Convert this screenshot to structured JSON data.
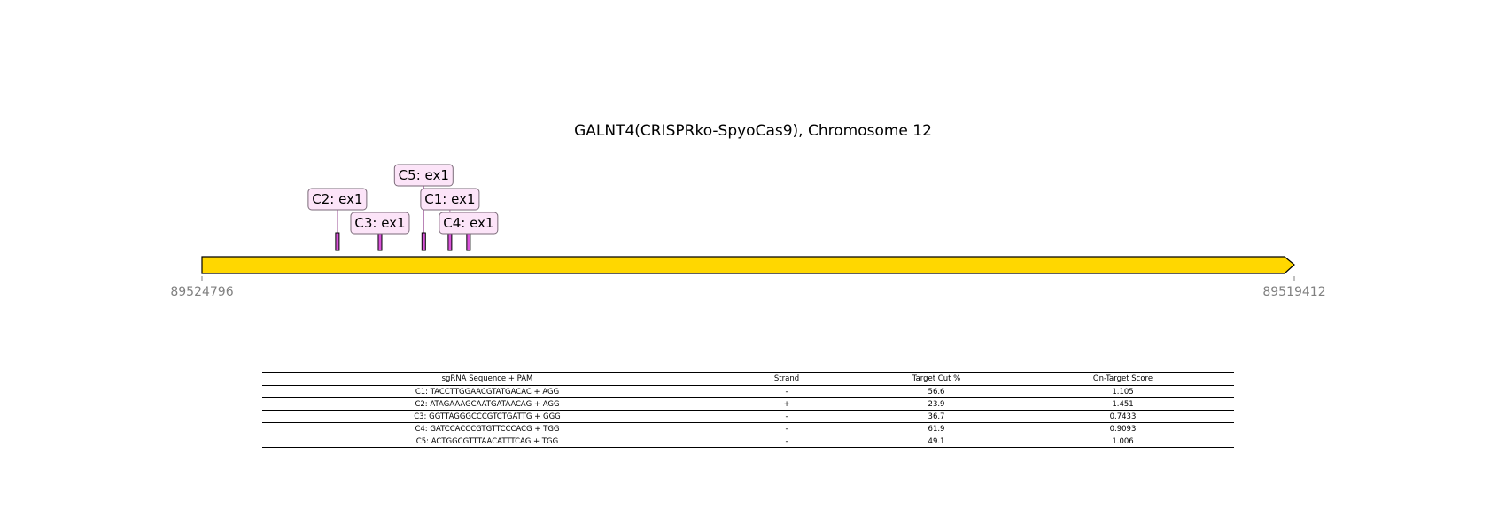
{
  "title": "GALNT4(CRISPRko-SpyoCas9), Chromosome 12",
  "gene": {
    "start_label": "89524796",
    "end_label": "89519412",
    "color": "#FFD700"
  },
  "guide_color": "#DA55DA",
  "label_fill": "#FCE4F8",
  "guides": [
    {
      "label": "C2: ex1",
      "pos": 0.124
    },
    {
      "label": "C3: ex1",
      "pos": 0.163
    },
    {
      "label": "C5: ex1",
      "pos": 0.203
    },
    {
      "label": "C1: ex1",
      "pos": 0.227
    },
    {
      "label": "C4: ex1",
      "pos": 0.244
    }
  ],
  "table": {
    "headers": [
      "sgRNA Sequence + PAM",
      "Strand",
      "Target Cut %",
      "On-Target Score"
    ],
    "rows": [
      [
        "C1: TACCTTGGAACGTATGACAC + AGG",
        "-",
        "56.6",
        "1.105"
      ],
      [
        "C2: ATAGAAAGCAATGATAACAG + AGG",
        "+",
        "23.9",
        "1.451"
      ],
      [
        "C3: GGTTAGGGCCCGTCTGATTG + GGG",
        "-",
        "36.7",
        "0.7433"
      ],
      [
        "C4: GATCCACCCGTGTTCCCACG + TGG",
        "-",
        "61.9",
        "0.9093"
      ],
      [
        "C5: ACTGGCGTTTAACATTTCAG + TGG",
        "-",
        "49.1",
        "1.006"
      ]
    ]
  }
}
